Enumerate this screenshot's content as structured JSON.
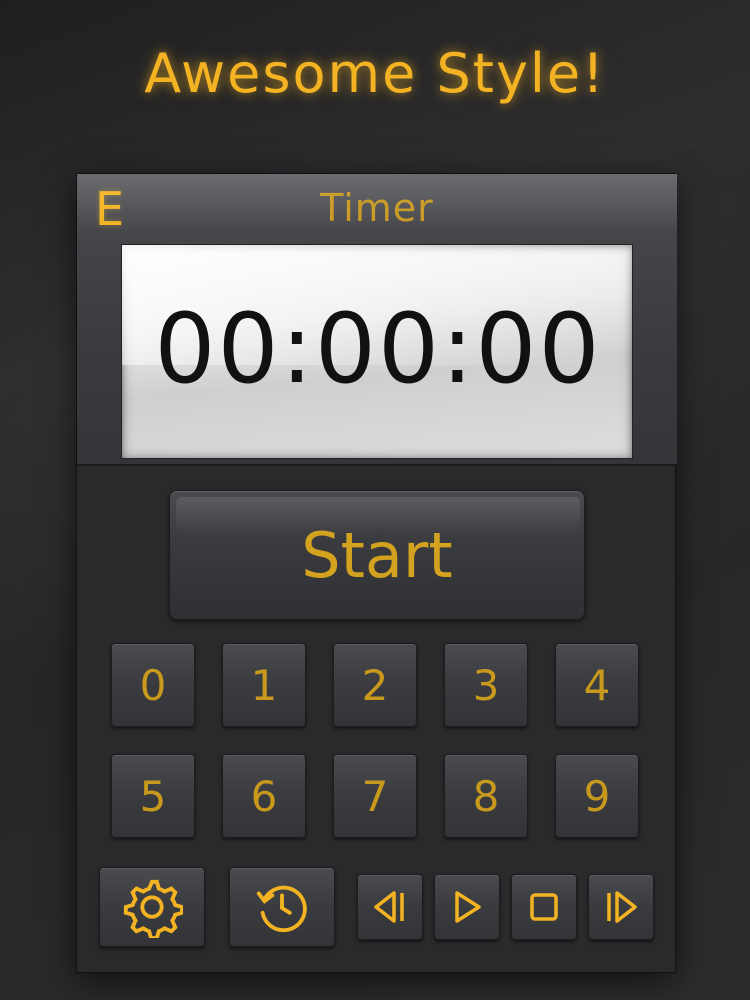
{
  "headline": "Awesome Style!",
  "panel": {
    "mode_letter": "E",
    "title": "Timer"
  },
  "display": {
    "time": "00:00:00"
  },
  "start_label": "Start",
  "keypad": [
    "0",
    "1",
    "2",
    "3",
    "4",
    "5",
    "6",
    "7",
    "8",
    "9"
  ],
  "controls": {
    "settings_icon": "gear-icon",
    "history_icon": "history-icon",
    "prev_icon": "skip-previous-icon",
    "play_icon": "play-icon",
    "stop_icon": "stop-icon",
    "next_icon": "skip-next-icon"
  },
  "colors": {
    "accent": "#f3b322",
    "button_text": "#c9991e",
    "lcd_text": "#111111"
  }
}
